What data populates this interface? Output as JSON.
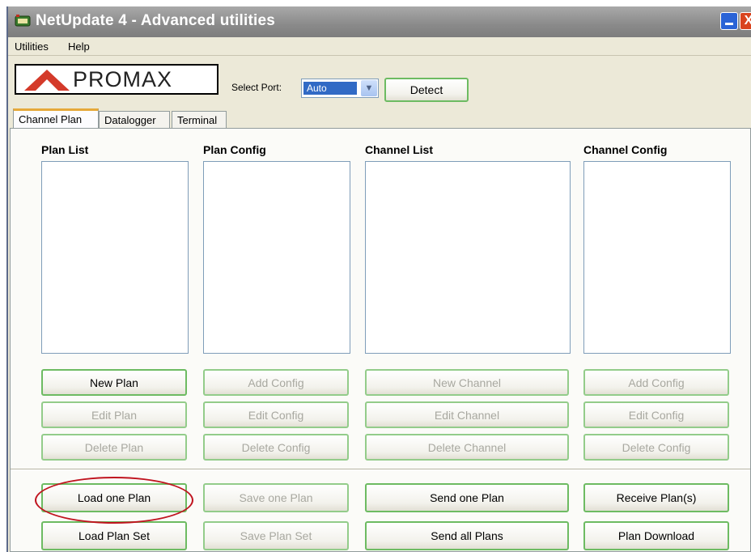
{
  "window": {
    "title": "NetUpdate 4 - Advanced utilities",
    "close_glyph": "X"
  },
  "menu": {
    "items": [
      "Utilities",
      "Help"
    ]
  },
  "toolbar": {
    "logo_text": "PROMAX",
    "port_label": "Select Port:",
    "port_value": "Auto",
    "detect_label": "Detect"
  },
  "tabs": [
    "Channel Plan",
    "Datalogger",
    "Terminal"
  ],
  "columns": [
    {
      "title": "Plan List",
      "buttons": [
        "New Plan",
        "Edit Plan",
        "Delete Plan"
      ]
    },
    {
      "title": "Plan Config",
      "buttons": [
        "Add Config",
        "Edit Config",
        "Delete Config"
      ]
    },
    {
      "title": "Channel List",
      "buttons": [
        "New Channel",
        "Edit Channel",
        "Delete Channel"
      ]
    },
    {
      "title": "Channel Config",
      "buttons": [
        "Add Config",
        "Edit Config",
        "Delete Config"
      ]
    }
  ],
  "actions": {
    "row1": [
      "Load one Plan",
      "Save one Plan",
      "Send one Plan",
      "Receive Plan(s)"
    ],
    "row2": [
      "Load Plan Set",
      "Save Plan Set",
      "Send all Plans",
      "Plan Download"
    ]
  },
  "colors": {
    "highlight_circle": "#c0141f",
    "button_border": "#6dbb62",
    "tab_accent": "#e6a93a",
    "logo_red": "#d43a2a"
  }
}
